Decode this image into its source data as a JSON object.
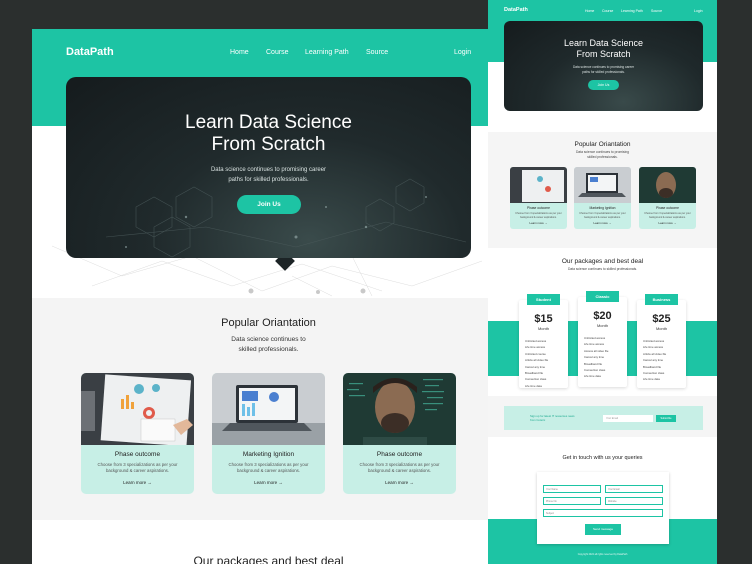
{
  "colors": {
    "accent": "#1dc4a4",
    "card_bg": "#c7efe6",
    "hero_bg": "#1b2325",
    "backdrop": "#2b2f2e"
  },
  "main": {
    "logo": "DataPath",
    "nav": [
      "Home",
      "Course",
      "Learning Path",
      "Source"
    ],
    "login": "Login",
    "hero": {
      "title_line1": "Learn Data Science",
      "title_line2": "From Scratch",
      "sub_line1": "Data science continues to promising career",
      "sub_line2": "paths for skilled professionals.",
      "cta": "Join Us"
    },
    "popular": {
      "title": "Popular Oriantation",
      "sub_line1": "Data science continues to",
      "sub_line2": "skilled professionals.",
      "cards": [
        {
          "title": "Phase outcome",
          "text_line1": "Choose from 3 specializations as per your",
          "text_line2": "background & career aspirations.",
          "link": "Learn more",
          "icon": "arrow-right-icon",
          "photo": "charts-notebook-photo"
        },
        {
          "title": "Marketing Ignition",
          "text_line1": "Choose from 3 specializations as per your",
          "text_line2": "background & career aspirations.",
          "link": "Learn more",
          "icon": "arrow-right-icon",
          "photo": "laptop-dashboard-photo"
        },
        {
          "title": "Phase outcome",
          "text_line1": "Choose from 3 specializations as per your",
          "text_line2": "background & career aspirations.",
          "link": "Learn more",
          "icon": "arrow-right-icon",
          "photo": "man-code-overlay-photo"
        }
      ]
    },
    "packages_title": "Our packages and best deal"
  },
  "preview": {
    "logo": "DataPath",
    "nav": [
      "Home",
      "Course",
      "Learning Path",
      "Source"
    ],
    "login": "Login",
    "hero": {
      "title_line1": "Learn Data Science",
      "title_line2": "From Scratch",
      "sub_line1": "Data science continues to promising career",
      "sub_line2": "paths for skilled professionals.",
      "cta": "Join Us"
    },
    "popular_title": "Popular Oriantation",
    "popular_sub_line1": "Data science continues to promising",
    "popular_sub_line2": "skilled professionals.",
    "cards": [
      {
        "title": "Phase outcome",
        "text": "Choose from 3 specializations as per your background & career aspirations.",
        "link": "Learn more →"
      },
      {
        "title": "Marketing Ignition",
        "text": "Choose from 3 specializations as per your background & career aspirations.",
        "link": "Learn more →"
      },
      {
        "title": "Phase outcome",
        "text": "Choose from 3 specializations as per your background & career aspirations.",
        "link": "Learn more →"
      }
    ],
    "packages_title": "Our packages and best deal",
    "packages_sub": "Data science continues to skilled professionals.",
    "plans": [
      {
        "name": "Student",
        "price": "$15",
        "period": "Month",
        "features": [
          "Unlimited access",
          "Life time access",
          "Unlimited course",
          "Article all video file",
          "Cancel any time",
          "Broadband file",
          "Connection class",
          "Life time data"
        ]
      },
      {
        "name": "Classic",
        "price": "$20",
        "period": "Month",
        "features": [
          "Unlimited access",
          "Life time access",
          "Access all video file",
          "Cancel any time",
          "Broadband file",
          "Connection class",
          "Life time data"
        ]
      },
      {
        "name": "Business",
        "price": "$25",
        "period": "Month",
        "features": [
          "Unlimited access",
          "Life time access",
          "Article all video file",
          "Cancel any time",
          "Broadband file",
          "Connection class",
          "Life time data"
        ]
      }
    ],
    "signup_text": "Sign up for latest IT resources news from Coterix",
    "signup_placeholder": "Your Email",
    "signup_button": "Subscribe",
    "contact_title": "Get in touch with us your queries",
    "form": {
      "name": "Your Name",
      "email": "Your Email",
      "phone": "Phone No",
      "website": "Website",
      "subject": "Subject",
      "send": "Send message"
    },
    "footer": "Copyright 2022 all rights reserved by DataPath"
  }
}
